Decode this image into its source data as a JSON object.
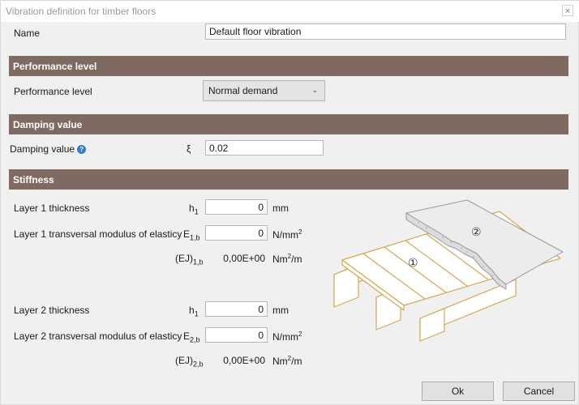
{
  "window": {
    "title": "Vibration definition for timber floors",
    "close_glyph": "×"
  },
  "name_row": {
    "label": "Name",
    "value": "Default floor vibration"
  },
  "sections": {
    "performance": "Performance level",
    "damping": "Damping value",
    "stiffness": "Stiffness"
  },
  "performance": {
    "label": "Performance level",
    "selected": "Normal demand",
    "chevron": "⌄"
  },
  "damping": {
    "label": "Damping value",
    "help": "?",
    "symbol": "ξ",
    "value": "0.02"
  },
  "layer1": {
    "thickness_label": "Layer 1 thickness",
    "thickness_sym": "h",
    "thickness_sub": "1",
    "thickness_value": "0",
    "thickness_unit": "mm",
    "modulus_label": "Layer 1 transversal modulus of elasticy",
    "modulus_sym": "E",
    "modulus_sub": "1,b",
    "modulus_value": "0",
    "modulus_unit": "N/mm",
    "modulus_unit_sup": "2",
    "ej_sym": "(EJ)",
    "ej_sub": "1,b",
    "ej_value": "0,00E+00",
    "ej_unit": "Nm",
    "ej_unit_sup": "2",
    "ej_unit_tail": "/m"
  },
  "layer2": {
    "thickness_label": "Layer 2 thickness",
    "thickness_sym": "h",
    "thickness_sub": "1",
    "thickness_value": "0",
    "thickness_unit": "mm",
    "modulus_label": "Layer 2 transversal modulus of elasticy",
    "modulus_sym": "E",
    "modulus_sub": "2,b",
    "modulus_value": "0",
    "modulus_unit": "N/mm",
    "modulus_unit_sup": "2",
    "ej_sym": "(EJ)",
    "ej_sub": "2,b",
    "ej_value": "0,00E+00",
    "ej_unit": "Nm",
    "ej_unit_sup": "2",
    "ej_unit_tail": "/m"
  },
  "illustration": {
    "layer1_mark": "①",
    "layer2_mark": "②"
  },
  "buttons": {
    "ok": "Ok",
    "cancel": "Cancel"
  }
}
